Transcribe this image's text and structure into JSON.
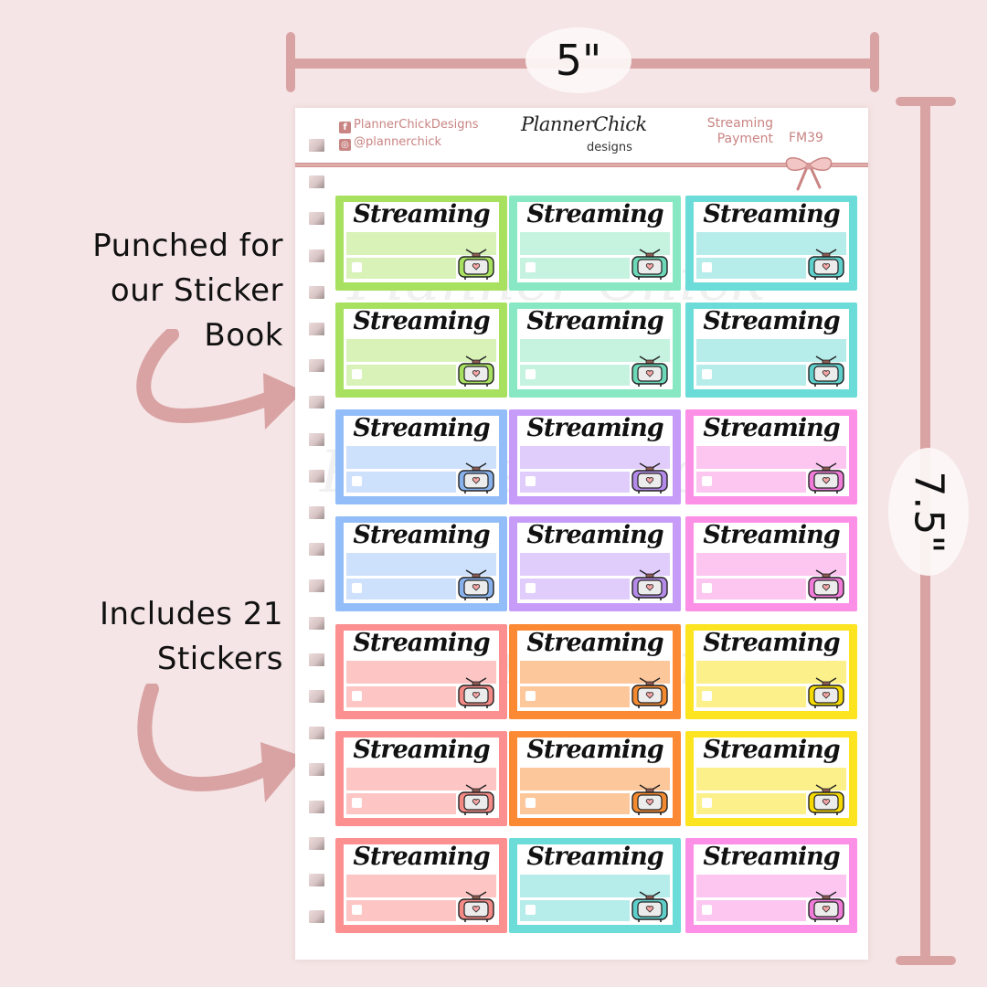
{
  "dimensions": {
    "width_label": "5\"",
    "height_label": "7.5\""
  },
  "captions": {
    "punched": [
      "Punched for",
      "our Sticker",
      "Book"
    ],
    "includes": [
      "Includes 21",
      "Stickers"
    ]
  },
  "header": {
    "facebook_icon": "facebook-icon",
    "facebook_handle": "PlannerChickDesigns",
    "instagram_icon": "instagram-icon",
    "instagram_handle": "@plannerchick",
    "logo_main": "PlannerChick",
    "logo_sub": "designs",
    "kit_name_line1": "Streaming",
    "kit_name_line2": "Payment",
    "code": "FM39",
    "accent_color": "#c98583"
  },
  "sticker_label": "Streaming",
  "sticker_count": 21,
  "stickers": [
    {
      "border": "#a8e060",
      "fill": "#d9f2b8",
      "tv": "#a8e060"
    },
    {
      "border": "#88e8c4",
      "fill": "#c6f3e0",
      "tv": "#6dd8b8"
    },
    {
      "border": "#6cdcd8",
      "fill": "#b6ecea",
      "tv": "#5fcfcb"
    },
    {
      "border": "#a8e060",
      "fill": "#d9f2b8",
      "tv": "#a8e060"
    },
    {
      "border": "#88e8c4",
      "fill": "#c6f3e0",
      "tv": "#6dd8b8"
    },
    {
      "border": "#6cdcd8",
      "fill": "#b6ecea",
      "tv": "#5fcfcb"
    },
    {
      "border": "#93bdf8",
      "fill": "#cde0fc",
      "tv": "#88b1ec"
    },
    {
      "border": "#c69cf8",
      "fill": "#e0cdfc",
      "tv": "#b58bea"
    },
    {
      "border": "#fc8fe6",
      "fill": "#fcc6f0",
      "tv": "#f07bd8"
    },
    {
      "border": "#93bdf8",
      "fill": "#cde0fc",
      "tv": "#88b1ec"
    },
    {
      "border": "#c69cf8",
      "fill": "#e0cdfc",
      "tv": "#b58bea"
    },
    {
      "border": "#fc8fe6",
      "fill": "#fcc6f0",
      "tv": "#f07bd8"
    },
    {
      "border": "#fc9090",
      "fill": "#fdc6c4",
      "tv": "#f38a86"
    },
    {
      "border": "#fc8a34",
      "fill": "#fdc79c",
      "tv": "#f48a30"
    },
    {
      "border": "#fce420",
      "fill": "#fcf08a",
      "tv": "#f5d900"
    },
    {
      "border": "#fc9090",
      "fill": "#fdc6c4",
      "tv": "#f38a86"
    },
    {
      "border": "#fc8a34",
      "fill": "#fdc79c",
      "tv": "#f48a30"
    },
    {
      "border": "#fce420",
      "fill": "#fcf08a",
      "tv": "#f5d900"
    },
    {
      "border": "#fc9090",
      "fill": "#fdc6c4",
      "tv": "#f38a86"
    },
    {
      "border": "#6cdcd8",
      "fill": "#b6ecea",
      "tv": "#5fcfcb"
    },
    {
      "border": "#fc8fe6",
      "fill": "#fcc6f0",
      "tv": "#f07bd8"
    }
  ],
  "watermark": "Planner Chick"
}
